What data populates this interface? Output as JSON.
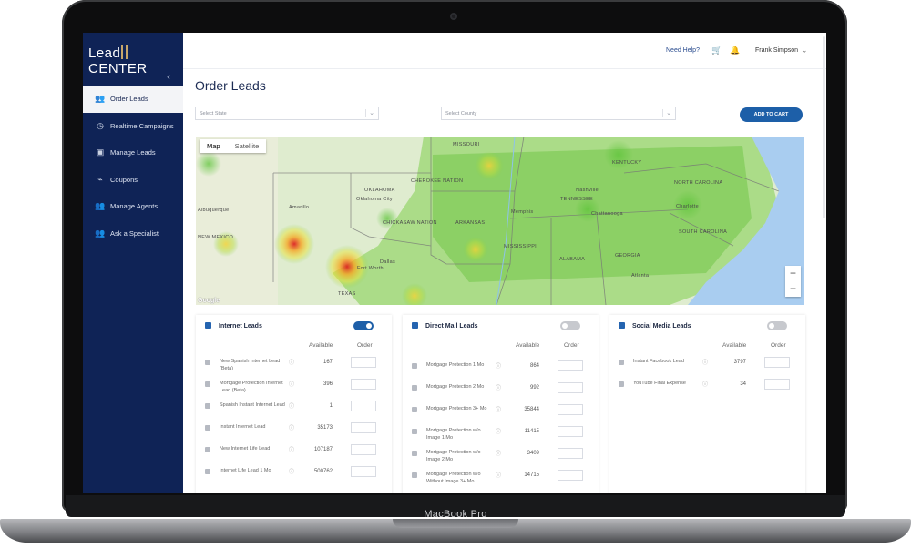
{
  "device": {
    "brand_label": "MacBook Pro"
  },
  "app": {
    "logo_left": "Lead",
    "logo_right": "CENTER",
    "collapse_icon": "chevron-left"
  },
  "sidebar": {
    "items": [
      {
        "label": "Order Leads",
        "icon": "group-icon",
        "glyph": "👥",
        "active": true
      },
      {
        "label": "Realtime Campaigns",
        "icon": "clock-icon",
        "glyph": "◷"
      },
      {
        "label": "Manage Leads",
        "icon": "id-card-icon",
        "glyph": "▣"
      },
      {
        "label": "Coupons",
        "icon": "tag-icon",
        "glyph": "⌁"
      },
      {
        "label": "Manage Agents",
        "icon": "users-icon",
        "glyph": "👥"
      },
      {
        "label": "Ask a Specialist",
        "icon": "people-icon",
        "glyph": "👥"
      }
    ]
  },
  "header": {
    "help": "Need Help?",
    "cart_icon": "cart-icon",
    "bell_icon": "bell-icon",
    "user_name": "Frank Simpson"
  },
  "page": {
    "title": "Order Leads",
    "state_placeholder": "Select State",
    "county_placeholder": "Select County",
    "add_to_cart": "ADD TO CART"
  },
  "map": {
    "tabs": [
      "Map",
      "Satellite"
    ],
    "active_tab": "Map",
    "zoom_in": "+",
    "zoom_out": "−",
    "attribution": "Google",
    "labels": [
      "MISSOURI",
      "KENTUCKY",
      "OKLAHOMA",
      "Oklahoma City",
      "CHEROKEE NATION",
      "CHICKASAW NATION",
      "ARKANSAS",
      "TENNESSEE",
      "NORTH CAROLINA",
      "Charlotte",
      "SOUTH CAROLINA",
      "MISSISSIPPI",
      "ALABAMA",
      "GEORGIA",
      "Dallas",
      "Fort Worth",
      "TEXAS",
      "NEW MEXICO",
      "Amarillo",
      "Albuquerque",
      "Nashville",
      "Atlanta",
      "Memphis",
      "Chattanooga"
    ]
  },
  "columns": {
    "available": "Available",
    "order": "Order"
  },
  "panels": [
    {
      "title": "Internet Leads",
      "enabled": true,
      "rows": [
        {
          "name": "New Spanish Internet Lead (Beta)",
          "available": "167"
        },
        {
          "name": "Mortgage Protection Internet Lead (Beta)",
          "available": "396"
        },
        {
          "name": "Spanish Instant Internet Lead",
          "available": "1"
        },
        {
          "name": "Instant Internet Lead",
          "available": "35173"
        },
        {
          "name": "New Internet Life Lead",
          "available": "107187"
        },
        {
          "name": "Internet Life Lead 1 Mo",
          "available": "500762"
        }
      ]
    },
    {
      "title": "Direct Mail Leads",
      "enabled": false,
      "rows": [
        {
          "name": "Mortgage Protection 1 Mo",
          "available": "864"
        },
        {
          "name": "Mortgage Protection 2 Mo",
          "available": "992"
        },
        {
          "name": "Mortgage Protection 3+ Mo",
          "available": "35844"
        },
        {
          "name": "Mortgage Protection w/o Image 1 Mo",
          "available": "11415"
        },
        {
          "name": "Mortgage Protection w/o Image 2 Mo",
          "available": "3409"
        },
        {
          "name": "Mortgage Protection w/o Without Image 3+ Mo",
          "available": "14715"
        }
      ]
    },
    {
      "title": "Social Media Leads",
      "enabled": false,
      "rows": [
        {
          "name": "Instant Facebook Lead",
          "available": "3797"
        },
        {
          "name": "YouTube Final Expense",
          "available": "34"
        }
      ]
    }
  ],
  "colors": {
    "sidebar_bg": "#0f2356",
    "accent": "#1d5fa8",
    "logo_gold": "#c7a66a"
  }
}
